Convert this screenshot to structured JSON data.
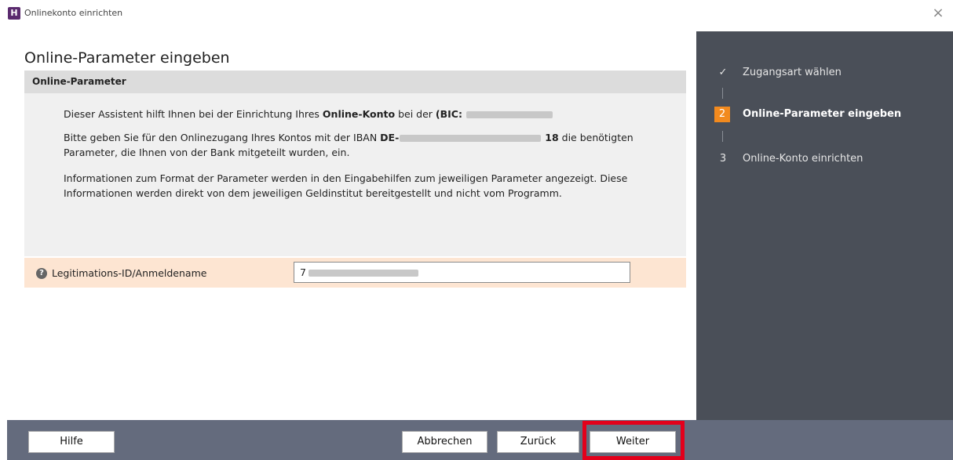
{
  "window": {
    "app_icon_letter": "H",
    "title": "Onlinekonto einrichten",
    "close_glyph": "×"
  },
  "main": {
    "heading": "Online-Parameter eingeben",
    "section_title": "Online-Parameter",
    "para1": {
      "text_a": "Dieser Assistent hilft Ihnen bei der Einrichtung Ihres ",
      "bold_a": "Online-Konto",
      "text_b": " bei der ",
      "bold_b": "(BIC: "
    },
    "para2": {
      "text_a": "Bitte geben Sie für den Onlinezugang Ihres Kontos mit der IBAN ",
      "bold_a": "DE-",
      "bold_b": "18",
      "text_b": " die benötigten Parameter, die Ihnen von der Bank mitgeteilt wurden, ein."
    },
    "para3": "Informationen zum Format der Parameter werden in den Eingabehilfen zum jeweiligen Parameter angezeigt. Diese Informationen werden direkt von dem jeweiligen Geldinstitut bereitgestellt und nicht vom Programm.",
    "param_label": "Legitimations-ID/Anmeldename",
    "param_value_prefix": "7",
    "help_glyph": "?"
  },
  "steps": [
    {
      "mark": "✓",
      "label": "Zugangsart wählen",
      "state": "done"
    },
    {
      "mark": "2",
      "label": "Online-Parameter eingeben",
      "state": "active"
    },
    {
      "mark": "3",
      "label": "Online-Konto einrichten",
      "state": "pending"
    }
  ],
  "footer": {
    "help_label": "Hilfe",
    "cancel_label": "Abbrechen",
    "back_label": "Zurück",
    "next_label": "Weiter"
  },
  "colors": {
    "sidebar": "#4a4f58",
    "footer": "#646b7d",
    "active_step": "#f28a1e",
    "param_row": "#fde5d2",
    "highlight": "#e3001b"
  }
}
